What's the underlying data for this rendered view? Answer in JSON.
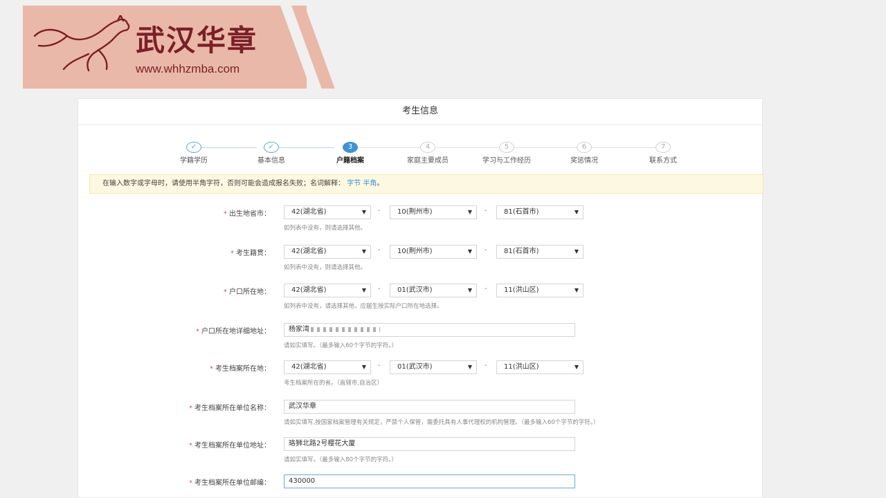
{
  "brand": {
    "title": "武汉华章",
    "url": "www.whhzmba.com"
  },
  "panel_title": "考生信息",
  "steps": [
    {
      "label": "学籍学历",
      "marker": "✓",
      "state": "done"
    },
    {
      "label": "基本信息",
      "marker": "✓",
      "state": "done"
    },
    {
      "label": "户籍档案",
      "marker": "3",
      "state": "active"
    },
    {
      "label": "家庭主要成员",
      "marker": "4",
      "state": "pending"
    },
    {
      "label": "学习与工作经历",
      "marker": "5",
      "state": "pending"
    },
    {
      "label": "奖惩情况",
      "marker": "6",
      "state": "pending"
    },
    {
      "label": "联系方式",
      "marker": "7",
      "state": "pending"
    }
  ],
  "notice": {
    "text": "在输入数字或字母时，请使用半角字符，否则可能会造成报名失败；名词解释：",
    "link1": "字节",
    "link2": "半角",
    "end": "。"
  },
  "form": {
    "birth_place": {
      "label": "出生地省市：",
      "province": "42(湖北省)",
      "city": "10(荆州市)",
      "county": "81(石首市)",
      "hint": "如列表中没有，则请选择其他。"
    },
    "native_place": {
      "label": "考生籍贯：",
      "province": "42(湖北省)",
      "city": "10(荆州市)",
      "county": "81(石首市)",
      "hint": "如列表中没有，则请选择其他。"
    },
    "hukou_place": {
      "label": "户口所在地：",
      "province": "42(湖北省)",
      "city": "01(武汉市)",
      "county": "11(洪山区)",
      "hint": "如列表中没有，请选择其他，应届生按实际户口所在地选择。"
    },
    "hukou_address": {
      "label": "户口所在地详细地址：",
      "value": "杨家湾",
      "hint": "请如实填写。（最多输入60个字节的字符。）"
    },
    "archive_place": {
      "label": "考生档案所在地：",
      "province": "42(湖北省)",
      "city": "01(武汉市)",
      "county": "11(洪山区)",
      "hint": "考生档案所在的省。（直辖市,自治区）"
    },
    "archive_unit_name": {
      "label": "考生档案所在单位名称：",
      "value": "武汉华章",
      "hint": "请如实填写,按国家档案管理有关规定，严禁个人保管，需委托具有人事代理权的机构管理。（最多输入60个字节的字符。）"
    },
    "archive_unit_address": {
      "label": "考生档案所在单位地址：",
      "value": "珞狮北路2号樱花大厦",
      "hint": "请如实填写。（最多输入80个字节的字符。）"
    },
    "archive_unit_zip": {
      "label": "考生档案所在单位邮编：",
      "value": "430000"
    },
    "required_mark": "*",
    "dash": "-",
    "caret": "▼"
  }
}
